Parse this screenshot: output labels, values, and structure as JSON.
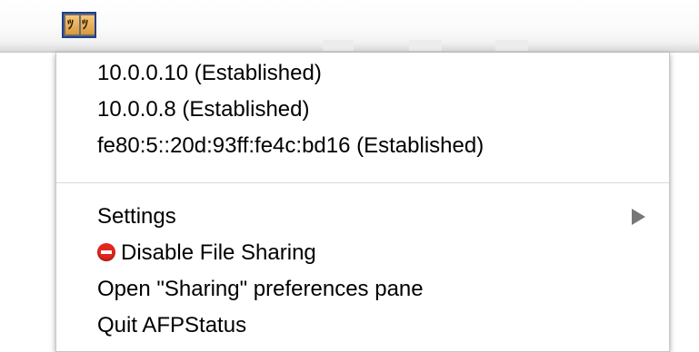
{
  "status_item": {
    "icon": "afpstatus-finder-icon"
  },
  "menu": {
    "connections": [
      "10.0.0.10 (Established)",
      "10.0.0.8 (Established)",
      "fe80:5::20d:93ff:fe4c:bd16 (Established)"
    ],
    "settings_label": "Settings",
    "disable_label": "Disable File Sharing",
    "disable_icon": "stop-icon",
    "open_prefs_label": "Open \"Sharing\" preferences pane",
    "quit_label": "Quit AFPStatus"
  }
}
